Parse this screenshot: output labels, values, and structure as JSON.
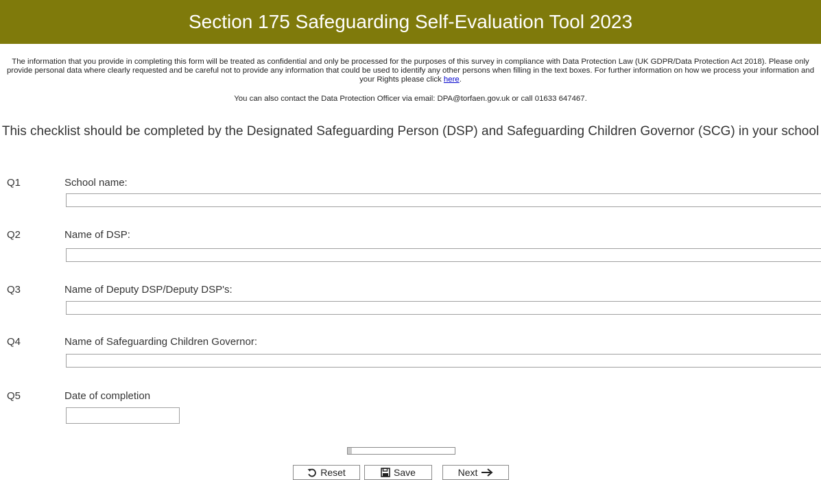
{
  "header": {
    "title": "Section 175 Safeguarding Self-Evaluation Tool 2023"
  },
  "privacy": {
    "text": "The information that you provide in completing this form will be treated as confidential and only be processed for the purposes of this survey in compliance with Data Protection Law (UK GDPR/Data Protection Act 2018). Please only provide personal data where clearly requested and be careful not to provide any information that could be used to identify any other persons when filling in the text boxes. For further information on how we process your information and your Rights please click ",
    "link_text": "here",
    "after_link": ".",
    "contact": "You can also contact the Data Protection Officer via email: DPA@torfaen.gov.uk or call 01633 647467."
  },
  "subtitle": "This checklist should be completed by the Designated Safeguarding Person (DSP) and Safeguarding Children Governor (SCG) in your school",
  "questions": [
    {
      "number": "Q1",
      "label": "School name:",
      "value": ""
    },
    {
      "number": "Q2",
      "label": "Name of DSP:",
      "value": ""
    },
    {
      "number": "Q3",
      "label": "Name of Deputy DSP/Deputy DSP's:",
      "value": ""
    },
    {
      "number": "Q4",
      "label": "Name of Safeguarding Children Governor:",
      "value": ""
    },
    {
      "number": "Q5",
      "label": "Date of completion",
      "value": ""
    }
  ],
  "progress": {
    "fraction": 0.0
  },
  "buttons": {
    "reset": {
      "label": "Reset",
      "icon": "undo-icon"
    },
    "save": {
      "label": "Save",
      "icon": "floppy-disk-icon"
    },
    "next": {
      "label": "Next",
      "icon": "arrow-right-icon"
    }
  }
}
